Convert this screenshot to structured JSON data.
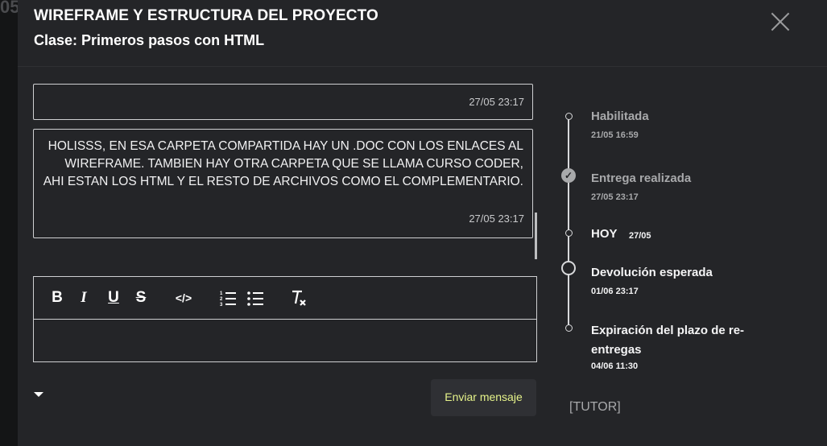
{
  "background": {
    "corner_text": "05"
  },
  "modal": {
    "title": "WIREFRAME Y ESTRUCTURA DEL PROYECTO",
    "subtitle": "Clase: Primeros pasos con HTML"
  },
  "messages": [
    {
      "text": "",
      "date": "27/05 23:17"
    },
    {
      "text": "HOLISSS, EN ESA CARPETA COMPARTIDA HAY UN .DOC CON LOS ENLACES AL WIREFRAME. TAMBIEN HAY OTRA CARPETA QUE SE LLAMA CURSO CODER, AHI ESTAN LOS HTML Y EL RESTO DE  ARCHIVOS COMO EL COMPLEMENTARIO.",
      "date": "27/05 23:17"
    }
  ],
  "editor": {
    "toolbar": {
      "bold": "B",
      "italic": "I",
      "underline": "U",
      "strike": "S",
      "code": "</>",
      "ordered_list": "≡",
      "bullet_list": "≡",
      "clear_format": "T"
    },
    "value": "",
    "send_label": "Enviar mensaje"
  },
  "timeline": [
    {
      "label": "Habilitada",
      "date": "21/05 16:59",
      "state": "muted"
    },
    {
      "label": "Entrega realizada",
      "date": "27/05 23:17",
      "state": "done"
    },
    {
      "label": "HOY",
      "date": "27/05",
      "state": "current"
    },
    {
      "label": "Devolución esperada",
      "date": "01/06 23:17",
      "state": "upcoming"
    },
    {
      "label": "Expiración del plazo de re-entregas",
      "date": "04/06 11:30",
      "state": "upcoming"
    }
  ],
  "role_tag": "[TUTOR]",
  "colors": {
    "accent": "#e6f38a",
    "panel": "#242528",
    "backdrop": "#1b1c1e"
  }
}
